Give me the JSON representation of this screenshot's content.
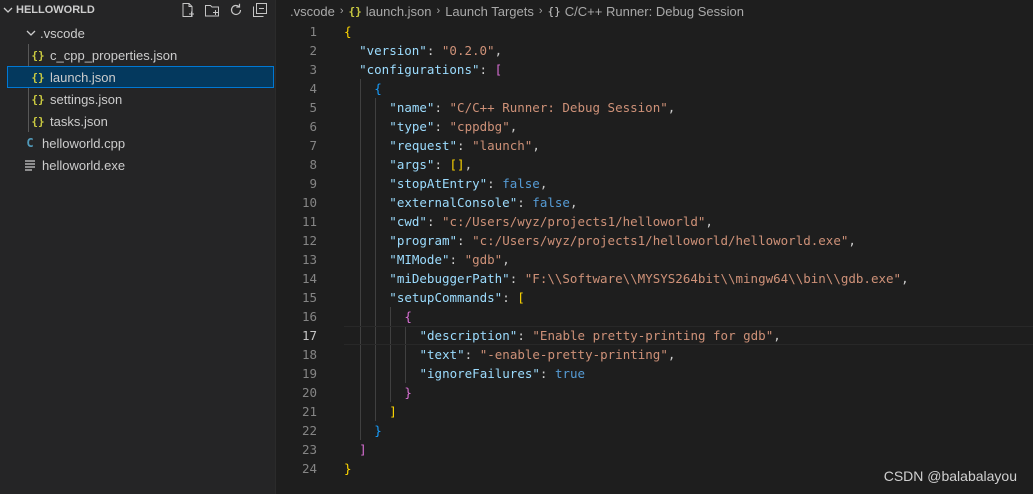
{
  "explorer": {
    "folder": "HELLOWORLD",
    "actions": [
      "new-file-icon",
      "new-folder-icon",
      "refresh-icon",
      "collapse-all-icon"
    ],
    "items": [
      {
        "label": ".vscode",
        "type": "folder"
      },
      {
        "label": "c_cpp_properties.json",
        "type": "json"
      },
      {
        "label": "launch.json",
        "type": "json",
        "selected": true
      },
      {
        "label": "settings.json",
        "type": "json"
      },
      {
        "label": "tasks.json",
        "type": "json"
      },
      {
        "label": "helloworld.cpp",
        "type": "cpp"
      },
      {
        "label": "helloworld.exe",
        "type": "exe"
      }
    ]
  },
  "breadcrumb": {
    "folder": ".vscode",
    "file": "launch.json",
    "section": "Launch Targets",
    "item": "C/C++ Runner: Debug Session"
  },
  "editor": {
    "current_line": 17,
    "lines": [
      "{",
      "\"version\": \"0.2.0\",",
      "\"configurations\": [",
      "{",
      "\"name\": \"C/C++ Runner: Debug Session\",",
      "\"type\": \"cppdbg\",",
      "\"request\": \"launch\",",
      "\"args\": [],",
      "\"stopAtEntry\": false,",
      "\"externalConsole\": false,",
      "\"cwd\": \"c:/Users/wyz/projects1/helloworld\",",
      "\"program\": \"c:/Users/wyz/projects1/helloworld/helloworld.exe\",",
      "\"MIMode\": \"gdb\",",
      "\"miDebuggerPath\": \"F:\\\\Software\\\\MYSYS264bit\\\\mingw64\\\\bin\\\\gdb.exe\",",
      "\"setupCommands\": [",
      "{",
      "\"description\": \"Enable pretty-printing for gdb\",",
      "\"text\": \"-enable-pretty-printing\",",
      "\"ignoreFailures\": true",
      "}",
      "]",
      "}",
      "]",
      "}"
    ]
  },
  "watermark": "CSDN @balabalayou",
  "colors": {
    "background": "#1e1e1e",
    "sidebar": "#252526",
    "selection": "#04395e",
    "key": "#9cdcfe",
    "string": "#ce9178",
    "boolean": "#569cd6",
    "json_icon": "#cbcb41"
  }
}
